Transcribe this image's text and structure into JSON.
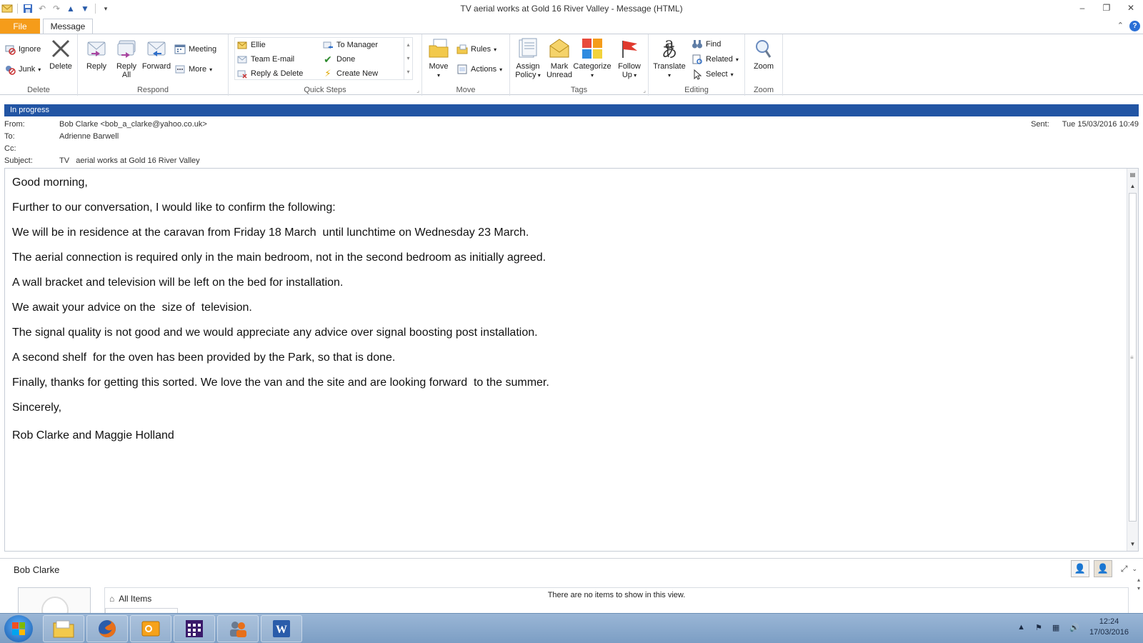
{
  "window": {
    "title": "TV   aerial works at Gold 16 River Valley  -  Message (HTML)",
    "minimize": "–",
    "restore": "❐",
    "close": "✕"
  },
  "tabs": {
    "file": "File",
    "message": "Message",
    "help": "?"
  },
  "ribbon": {
    "delete": {
      "ignore": "Ignore",
      "junk": "Junk",
      "delete": "Delete",
      "label": "Delete"
    },
    "respond": {
      "reply": "Reply",
      "reply_all_1": "Reply",
      "reply_all_2": "All",
      "forward": "Forward",
      "meeting": "Meeting",
      "more": "More",
      "label": "Respond"
    },
    "quick_steps": {
      "items": [
        "Ellie",
        "To Manager",
        "Team E-mail",
        "Done",
        "Reply & Delete",
        "Create New"
      ],
      "label": "Quick Steps"
    },
    "move": {
      "move": "Move",
      "rules": "Rules",
      "actions": "Actions",
      "label": "Move"
    },
    "tags": {
      "assign_1": "Assign",
      "assign_2": "Policy",
      "mark_1": "Mark",
      "mark_2": "Unread",
      "categorize": "Categorize",
      "follow_1": "Follow",
      "follow_2": "Up",
      "label": "Tags"
    },
    "editing": {
      "translate": "Translate",
      "find": "Find",
      "related": "Related",
      "select": "Select",
      "label": "Editing"
    },
    "zoom": {
      "zoom": "Zoom",
      "label": "Zoom"
    }
  },
  "infobar": {
    "text": "In progress"
  },
  "header": {
    "from_label": "From:",
    "from_value": "Bob Clarke <bob_a_clarke@yahoo.co.uk>",
    "to_label": "To:",
    "to_value": "Adrienne Barwell",
    "cc_label": "Cc:",
    "cc_value": "",
    "subject_label": "Subject:",
    "subject_value": "TV   aerial works at Gold 16 River Valley",
    "sent_label": "Sent:",
    "sent_value": "Tue 15/03/2016 10:49"
  },
  "body": {
    "lines": [
      "Good morning,",
      "Further to our conversation, I would like to confirm the following:",
      "We will be in residence at the caravan from Friday 18 March  until lunchtime on Wednesday 23 March.",
      "The aerial connection is required only in the main bedroom, not in the second bedroom as initially agreed.",
      "A wall bracket and television will be left on the bed for installation.",
      "We await your advice on the  size of  television.",
      "The signal quality is not good and we would appreciate any advice over signal boosting post installation.",
      "A second shelf  for the oven has been provided by the Park, so that is done.",
      "Finally, thanks for getting this sorted. We love the van and the site and are looking forward  to the summer.",
      "Sincerely,",
      "Rob Clarke and Maggie Holland"
    ]
  },
  "people_pane": {
    "name": "Bob Clarke",
    "all_items": "All Items",
    "empty": "There are no items to show in this view."
  },
  "taskbar": {
    "time": "12:24",
    "date": "17/03/2016"
  },
  "colors": {
    "file_tab": "#f59c1a",
    "infobar": "#2255a4",
    "taskbar": "#8aaad0"
  }
}
